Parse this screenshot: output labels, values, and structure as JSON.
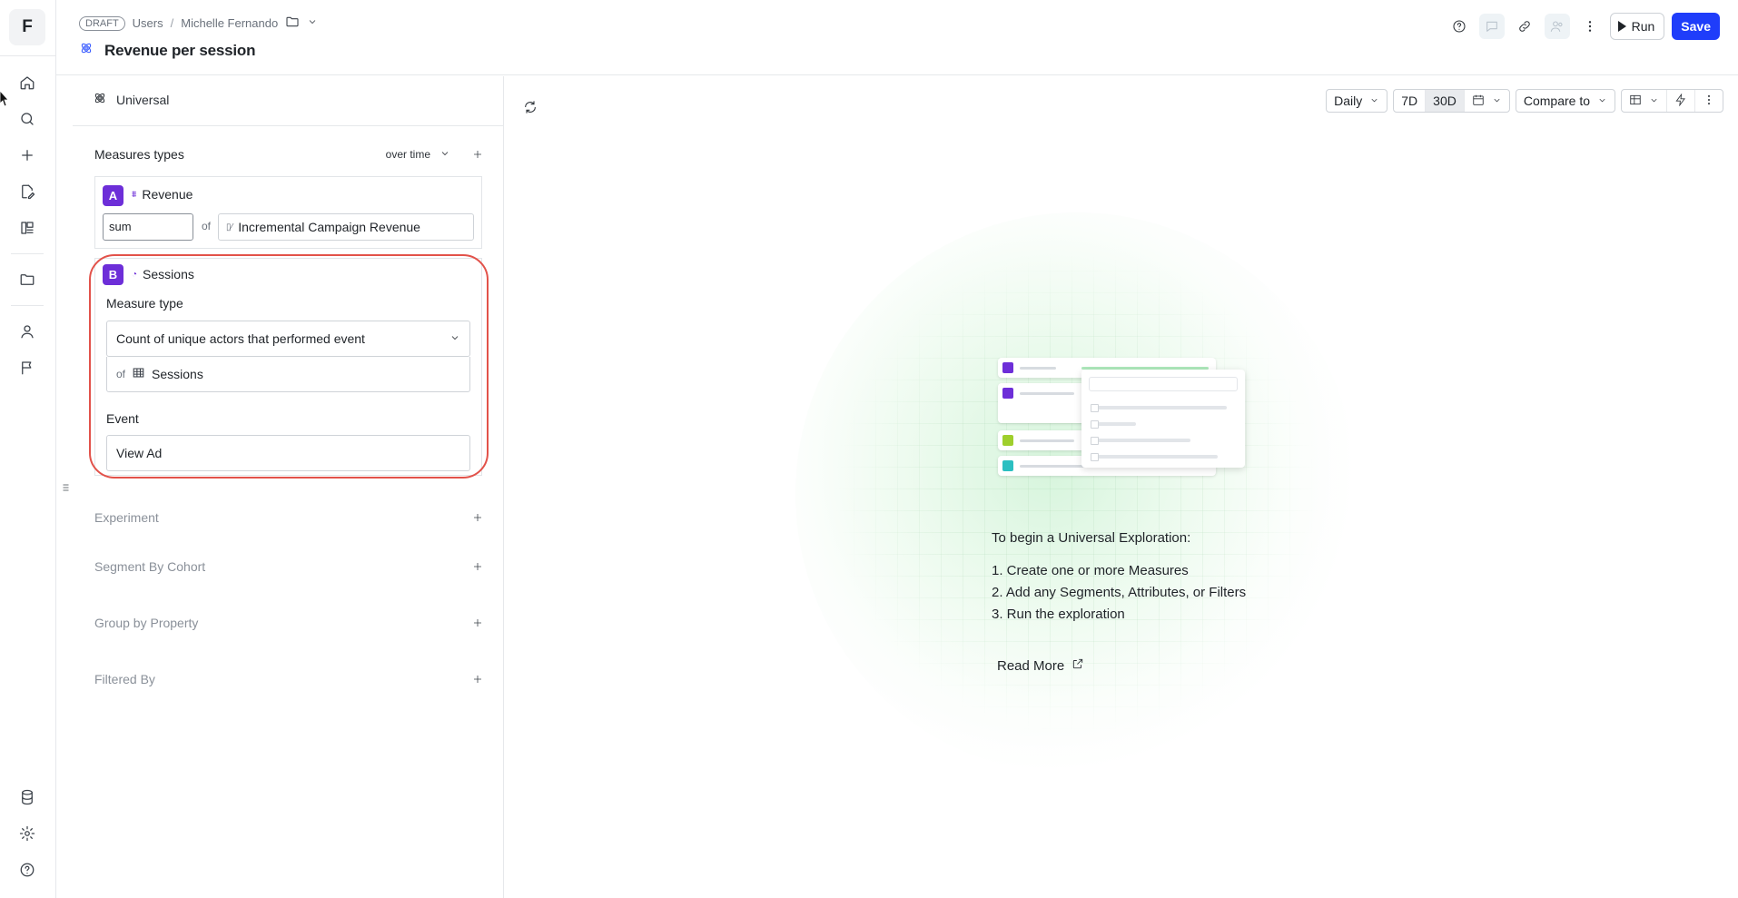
{
  "app": {
    "logo_letter": "F"
  },
  "header": {
    "status_badge": "DRAFT",
    "breadcrumb": [
      "Users",
      "Michelle Fernando"
    ],
    "separator": "/",
    "title": "Revenue per session",
    "run_label": "Run",
    "save_label": "Save",
    "accent_color": "#1f3dfa"
  },
  "sidebar": {
    "nav_icons": [
      "home-icon",
      "search-icon",
      "plus-icon",
      "edit-file-icon",
      "board-icon",
      "folder-icon",
      "user-icon",
      "flag-icon"
    ],
    "bottom_icons": [
      "database-icon",
      "gear-icon",
      "help-icon"
    ]
  },
  "panel": {
    "universal_label": "Universal",
    "measures_label": "Measures types",
    "over_time_label": "over time",
    "measure_a": {
      "letter": "A",
      "name": "Revenue",
      "aggregation": "sum",
      "of_label": "of",
      "property": "Incremental Campaign Revenue"
    },
    "measure_b": {
      "letter": "B",
      "name": "Sessions",
      "measure_type_label": "Measure type",
      "measure_type_value": "Count of unique actors that performed event",
      "of_label": "of",
      "of_value": "Sessions",
      "event_label": "Event",
      "event_value": "View Ad"
    },
    "sections": [
      "Experiment",
      "Segment By Cohort",
      "Group by Property",
      "Filtered By"
    ],
    "badge_color": "#6d2ed8",
    "highlight_color": "#e2524a"
  },
  "toolbar": {
    "granularity": "Daily",
    "range_7d": "7D",
    "range_30d": "30D",
    "active_range": "30D",
    "compare_label": "Compare to"
  },
  "empty_state": {
    "heading": "To begin a Universal Exploration:",
    "steps": [
      "1. Create one or more Measures",
      "2. Add any Segments, Attributes, or Filters",
      "3. Run the exploration"
    ],
    "read_more": "Read More"
  }
}
